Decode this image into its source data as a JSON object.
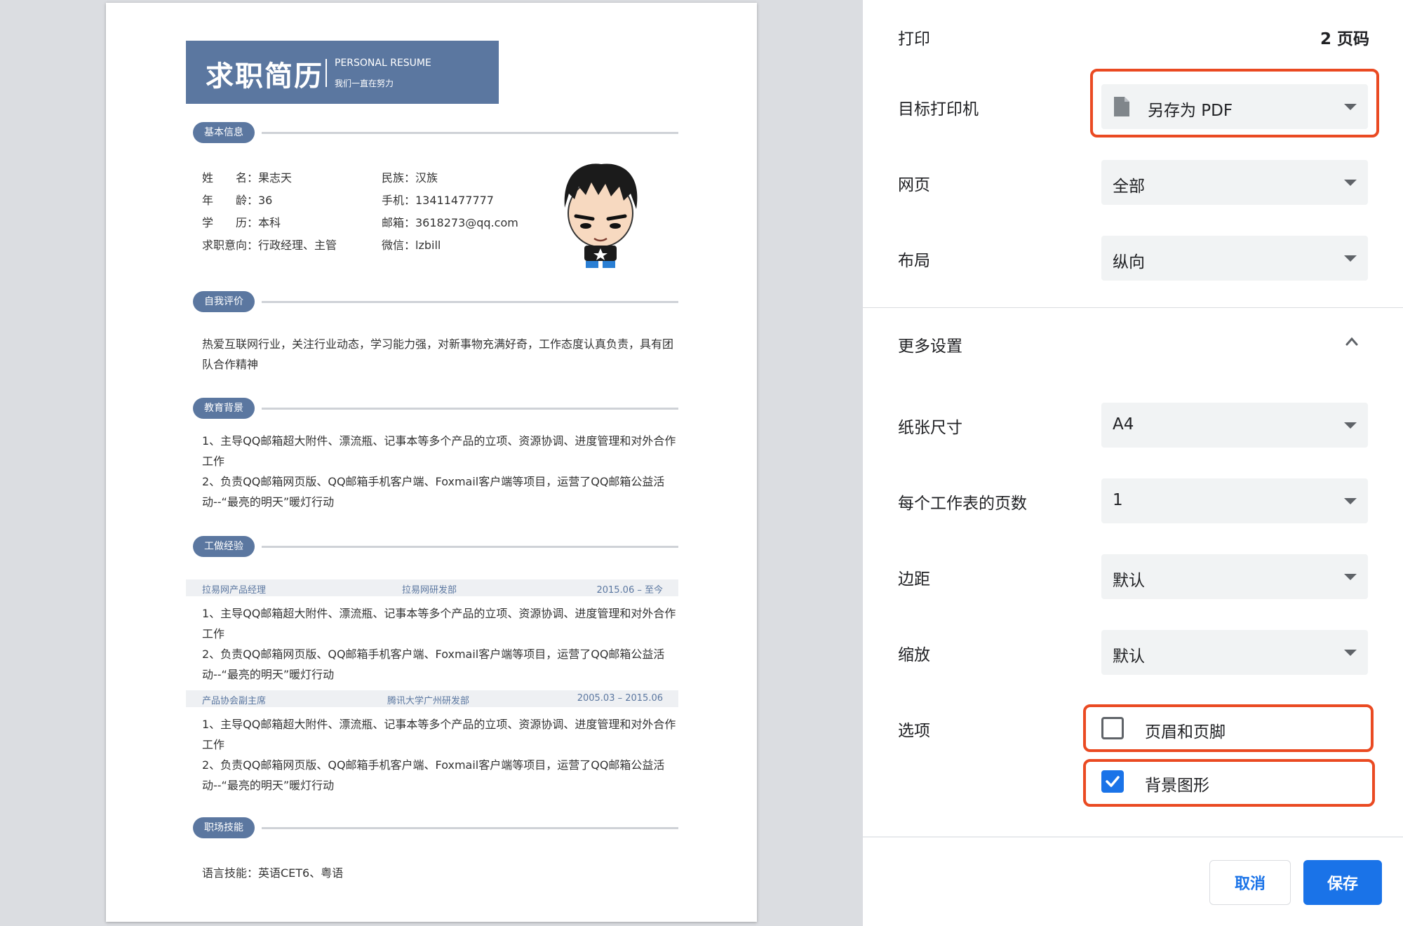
{
  "resume": {
    "title": "求职简历",
    "title_en": "PERSONAL RESUME",
    "subtitle": "我们一直在努力",
    "sections": {
      "basic": "基本信息",
      "self_eval": "自我评价",
      "education": "教育背景",
      "work": "工做经验",
      "skills": "职场技能"
    },
    "basic_info": {
      "name": "姓　　名：果志天",
      "age": "年　　龄：36",
      "degree": "学　　历：本科",
      "intent": "求职意向：行政经理、主管",
      "ethnicity": "民族：汉族",
      "phone": "手机：13411477777",
      "email": "邮箱：3618273@qq.com",
      "wechat": "微信：lzbill"
    },
    "self_eval_text": "热爱互联网行业，关注行业动态，学习能力强，对新事物充满好奇，工作态度认真负责，具有团队合作精神",
    "edu_text_1": "1、主导QQ邮箱超大附件、漂流瓶、记事本等多个产品的立项、资源协调、进度管理和对外合作工作",
    "edu_text_2": "2、负责QQ邮箱网页版、QQ邮箱手机客户端、Foxmail客户端等项目，运营了QQ邮箱公益活动--“最亮的明天”暖灯行动",
    "jobs": [
      {
        "title": "拉易网产品经理",
        "company": "拉易网研发部",
        "period": "2015.06 – 至今",
        "text_1": "1、主导QQ邮箱超大附件、漂流瓶、记事本等多个产品的立项、资源协调、进度管理和对外合作工作",
        "text_2": "2、负责QQ邮箱网页版、QQ邮箱手机客户端、Foxmail客户端等项目，运营了QQ邮箱公益活动--“最亮的明天”暖灯行动"
      },
      {
        "title": "产品协会副主席",
        "company": "腾讯大学广州研发部",
        "period": "2005.03 – 2015.06",
        "text_1": "1、主导QQ邮箱超大附件、漂流瓶、记事本等多个产品的立项、资源协调、进度管理和对外合作工作",
        "text_2": "2、负责QQ邮箱网页版、QQ邮箱手机客户端、Foxmail客户端等项目，运营了QQ邮箱公益活动--“最亮的明天”暖灯行动"
      }
    ],
    "skills_text": "语言技能：英语CET6、粤语"
  },
  "print": {
    "title": "打印",
    "page_count": "2 页码",
    "destination": {
      "label": "目标打印机",
      "value": "另存为 PDF"
    },
    "pages": {
      "label": "网页",
      "value": "全部"
    },
    "layout": {
      "label": "布局",
      "value": "纵向"
    },
    "more_settings": "更多设置",
    "paper_size": {
      "label": "纸张尺寸",
      "value": "A4"
    },
    "pages_per_sheet": {
      "label": "每个工作表的页数",
      "value": "1"
    },
    "margins": {
      "label": "边距",
      "value": "默认"
    },
    "scale": {
      "label": "缩放",
      "value": "默认"
    },
    "options": {
      "label": "选项",
      "headers_footers": {
        "label": "页眉和页脚",
        "checked": false
      },
      "background_graphics": {
        "label": "背景图形",
        "checked": true
      }
    },
    "cancel": "取消",
    "save": "保存"
  },
  "colors": {
    "accent": "#1a73e8",
    "highlight": "#ea4a22",
    "resume_blue": "#5b77a0"
  },
  "icons": {
    "destination": "document-icon",
    "dropdown": "caret-down-icon",
    "more_settings": "chevron-up-icon",
    "checkbox_checked": "check-icon"
  }
}
